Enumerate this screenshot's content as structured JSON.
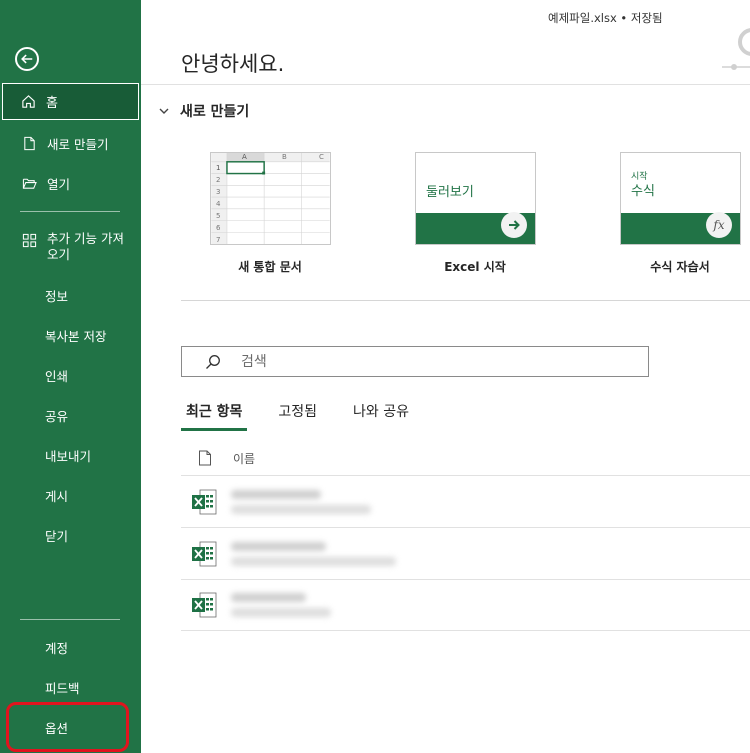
{
  "header": {
    "doc_name": "예제파일.xlsx • 저장됨",
    "greeting": "안녕하세요."
  },
  "sidebar": {
    "home": "홈",
    "new": "새로 만들기",
    "open": "열기",
    "addins": "추가 기능 가져\n오기",
    "info": "정보",
    "save_copy": "복사본 저장",
    "print": "인쇄",
    "share": "공유",
    "export": "내보내기",
    "publish": "게시",
    "close": "닫기",
    "account": "계정",
    "feedback": "피드백",
    "options": "옵션"
  },
  "new_section": {
    "title": "새로 만들기",
    "templates": [
      {
        "label": "새 통합 문서"
      },
      {
        "label": "Excel 시작",
        "thumb_text": "둘러보기"
      },
      {
        "label": "수식 자습서",
        "thumb_small": "시작",
        "thumb_big": "수식"
      }
    ],
    "grid_cols": [
      "A",
      "B",
      "C"
    ],
    "grid_rows": [
      "1",
      "2",
      "3",
      "4",
      "5",
      "6",
      "7"
    ]
  },
  "search": {
    "placeholder": "검색"
  },
  "tabs": [
    "최근 항목",
    "고정됨",
    "나와 공유"
  ],
  "list": {
    "header_name": "이름"
  },
  "colors": {
    "brand": "#217346",
    "brand_dark": "#185c37",
    "highlight": "#e0141e"
  }
}
